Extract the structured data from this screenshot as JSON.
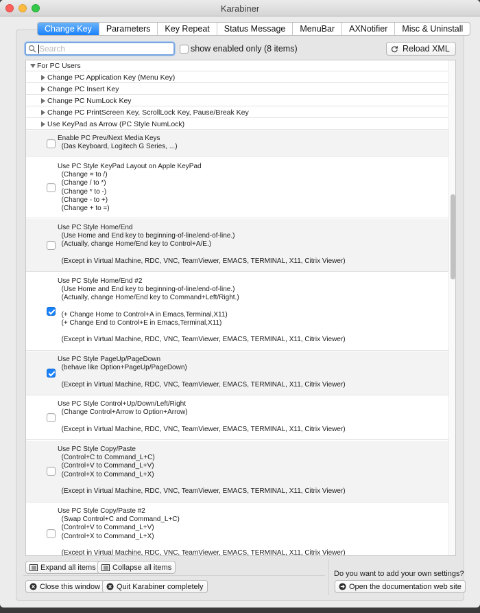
{
  "window": {
    "title": "Karabiner"
  },
  "tabs": [
    {
      "label": "Change Key",
      "active": true
    },
    {
      "label": "Parameters",
      "active": false
    },
    {
      "label": "Key Repeat",
      "active": false
    },
    {
      "label": "Status Message",
      "active": false
    },
    {
      "label": "MenuBar",
      "active": false
    },
    {
      "label": "AXNotifier",
      "active": false
    },
    {
      "label": "Misc & Uninstall",
      "active": false
    }
  ],
  "search": {
    "placeholder": "Search",
    "value": ""
  },
  "show_enabled": {
    "label": "show enabled only (8 items)",
    "checked": false
  },
  "reload_button": {
    "label": "Reload XML",
    "icon": "reload-icon"
  },
  "tree": {
    "group": {
      "label": "For PC Users",
      "expanded": true
    },
    "subgroups": [
      "Change PC Application Key (Menu Key)",
      "Change PC Insert Key",
      "Change PC NumLock Key",
      "Change PC PrintScreen Key, ScrollLock Key, Pause/Break Key",
      "Use KeyPad as Arrow (PC Style NumLock)"
    ],
    "settings": [
      {
        "checked": false,
        "lines": [
          "Enable PC Prev/Next Media Keys",
          "  (Das Keyboard, Logitech G Series, ...)"
        ]
      },
      {
        "checked": false,
        "lines": [
          "Use PC Style KeyPad Layout on Apple KeyPad",
          "  (Change = to /)",
          "  (Change / to *)",
          "  (Change * to -)",
          "  (Change - to +)",
          "  (Change + to =)"
        ]
      },
      {
        "checked": false,
        "lines": [
          "Use PC Style Home/End",
          "  (Use Home and End key to beginning-of-line/end-of-line.)",
          "  (Actually, change Home/End key to Control+A/E.)",
          "",
          "  (Except in Virtual Machine, RDC, VNC, TeamViewer, EMACS, TERMINAL, X11, Citrix Viewer)"
        ]
      },
      {
        "checked": true,
        "lines": [
          "Use PC Style Home/End #2",
          "  (Use Home and End key to beginning-of-line/end-of-line.)",
          "  (Actually, change Home/End key to Command+Left/Right.)",
          "",
          "  (+ Change Home to Control+A in Emacs,Terminal,X11)",
          "  (+ Change End to Control+E in Emacs,Terminal,X11)",
          "",
          "  (Except in Virtual Machine, RDC, VNC, TeamViewer, EMACS, TERMINAL, X11, Citrix Viewer)"
        ]
      },
      {
        "checked": true,
        "lines": [
          "Use PC Style PageUp/PageDown",
          "  (behave like Option+PageUp/PageDown)",
          "",
          "  (Except in Virtual Machine, RDC, VNC, TeamViewer, EMACS, TERMINAL, X11, Citrix Viewer)"
        ]
      },
      {
        "checked": false,
        "lines": [
          "Use PC Style Control+Up/Down/Left/Right",
          "  (Change Control+Arrow to Option+Arrow)",
          "",
          "  (Except in Virtual Machine, RDC, VNC, TeamViewer, EMACS, TERMINAL, X11, Citrix Viewer)"
        ]
      },
      {
        "checked": false,
        "lines": [
          "Use PC Style Copy/Paste",
          "  (Control+C to Command_L+C)",
          "  (Control+V to Command_L+V)",
          "  (Control+X to Command_L+X)",
          "",
          "  (Except in Virtual Machine, RDC, VNC, TeamViewer, EMACS, TERMINAL, X11, Citrix Viewer)"
        ]
      },
      {
        "checked": false,
        "lines": [
          "Use PC Style Copy/Paste #2",
          "  (Swap Control+C and Command_L+C)",
          "  (Control+V to Command_L+V)",
          "  (Control+X to Command_L+X)",
          "",
          "  (Except in Virtual Machine, RDC, VNC, TeamViewer, EMACS, TERMINAL, X11, Citrix Viewer)"
        ]
      }
    ]
  },
  "footer": {
    "expand_label": "Expand all items",
    "collapse_label": "Collapse all items",
    "close_label": "Close this window",
    "quit_label": "Quit Karabiner completely",
    "ask_label": "Do you want to add your own settings?",
    "docs_label": "Open the documentation web site"
  },
  "colors": {
    "accent": "#1a82fb",
    "window_bg": "#ececec"
  }
}
